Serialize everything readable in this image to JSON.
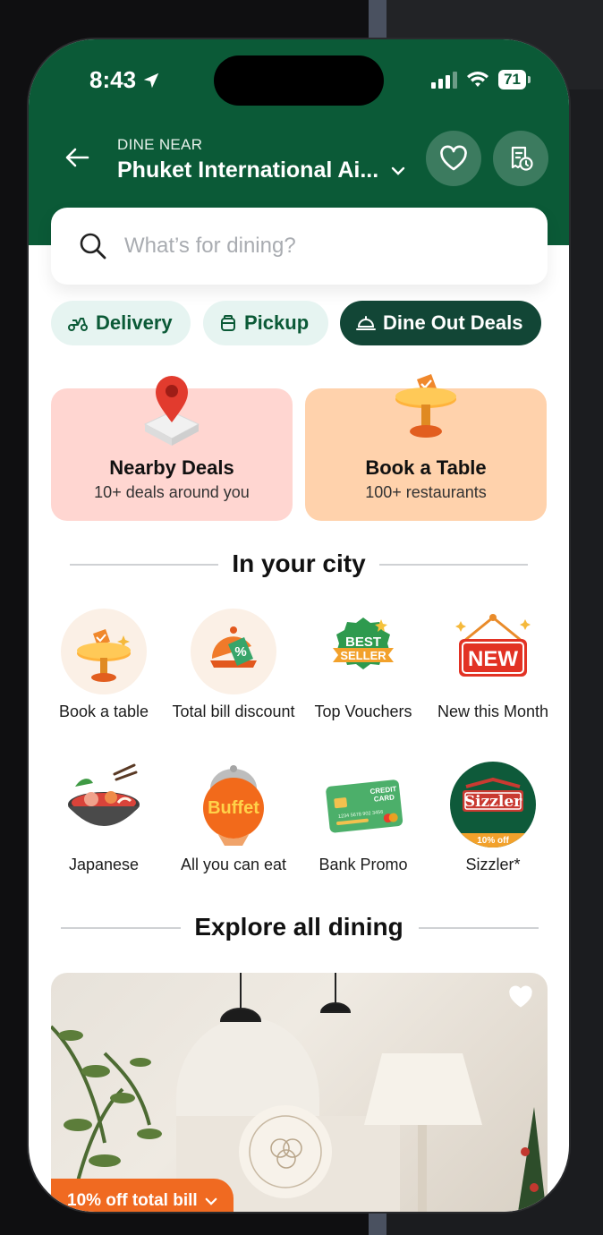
{
  "status": {
    "time": "8:43",
    "battery": "71"
  },
  "header": {
    "eyebrow": "DINE NEAR",
    "location": "Phuket International Ai..."
  },
  "search": {
    "placeholder": "What’s for dining?"
  },
  "chips": [
    {
      "label": "Delivery",
      "icon": "scooter-icon"
    },
    {
      "label": "Pickup",
      "icon": "bag-icon"
    },
    {
      "label": "Dine Out Deals",
      "icon": "cloche-icon"
    }
  ],
  "cards": [
    {
      "title": "Nearby Deals",
      "subtitle": "10+ deals around you",
      "color": "#ffd6d1"
    },
    {
      "title": "Book a Table",
      "subtitle": "100+ restaurants",
      "color": "#ffd2ac"
    }
  ],
  "city": {
    "title": "In your city",
    "items": [
      {
        "label": "Book a table",
        "icon": "table-booking-icon"
      },
      {
        "label": "Total bill discount",
        "icon": "percent-cloche-icon"
      },
      {
        "label": "Top Vouchers",
        "icon": "best-seller-badge-icon",
        "badge_text": [
          "BEST",
          "SELLER"
        ]
      },
      {
        "label": "New this Month",
        "icon": "new-sign-icon",
        "badge_text": "NEW"
      },
      {
        "label": "Japanese",
        "icon": "hotpot-icon"
      },
      {
        "label": "All you can eat",
        "icon": "buffet-icon",
        "badge_text": "Buffet"
      },
      {
        "label": "Bank Promo",
        "icon": "credit-card-icon",
        "badge_text": [
          "CREDIT",
          "CARD",
          "1234 5678 902 3456"
        ]
      },
      {
        "label": "Sizzler*",
        "icon": "sizzler-logo-icon",
        "badge_text": [
          "Sizzler",
          "10% off"
        ]
      }
    ]
  },
  "explore": {
    "title": "Explore all dining"
  },
  "listing": {
    "promo": "10% off total bill"
  },
  "colors": {
    "brand": "#0b5a37",
    "accent": "#f06a21",
    "chip_bg": "#e6f4f1"
  }
}
